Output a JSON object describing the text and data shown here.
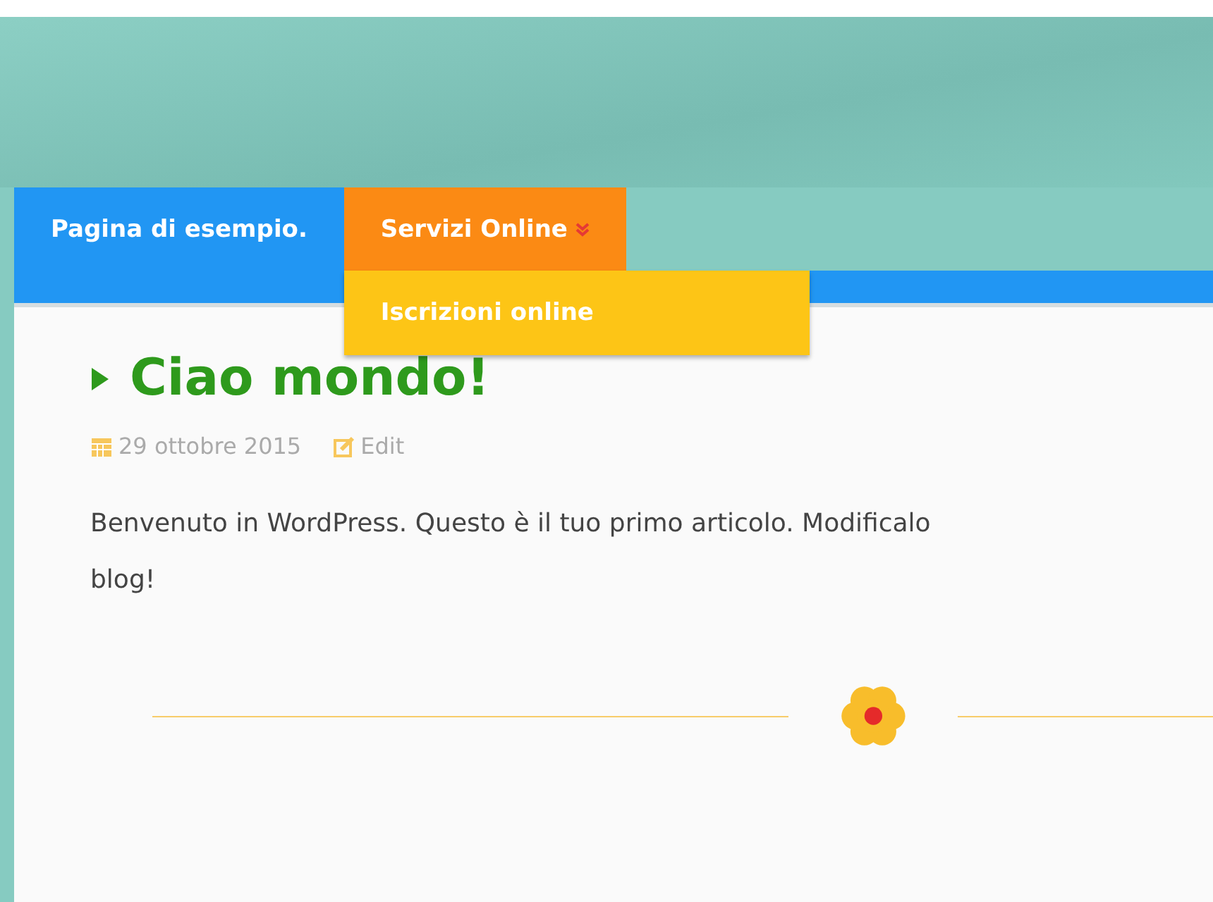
{
  "nav": {
    "items": [
      {
        "label": "Pagina di esempio.",
        "selected": false
      },
      {
        "label": "Servizi Online",
        "selected": true,
        "expanded": true,
        "children": [
          {
            "label": "Iscrizioni online"
          }
        ]
      }
    ]
  },
  "post": {
    "title": "Ciao mondo!",
    "date": "29 ottobre 2015",
    "edit": "Edit",
    "lines": [
      "Benvenuto in WordPress. Questo è il tuo primo articolo. Modificalo",
      "blog!"
    ]
  }
}
